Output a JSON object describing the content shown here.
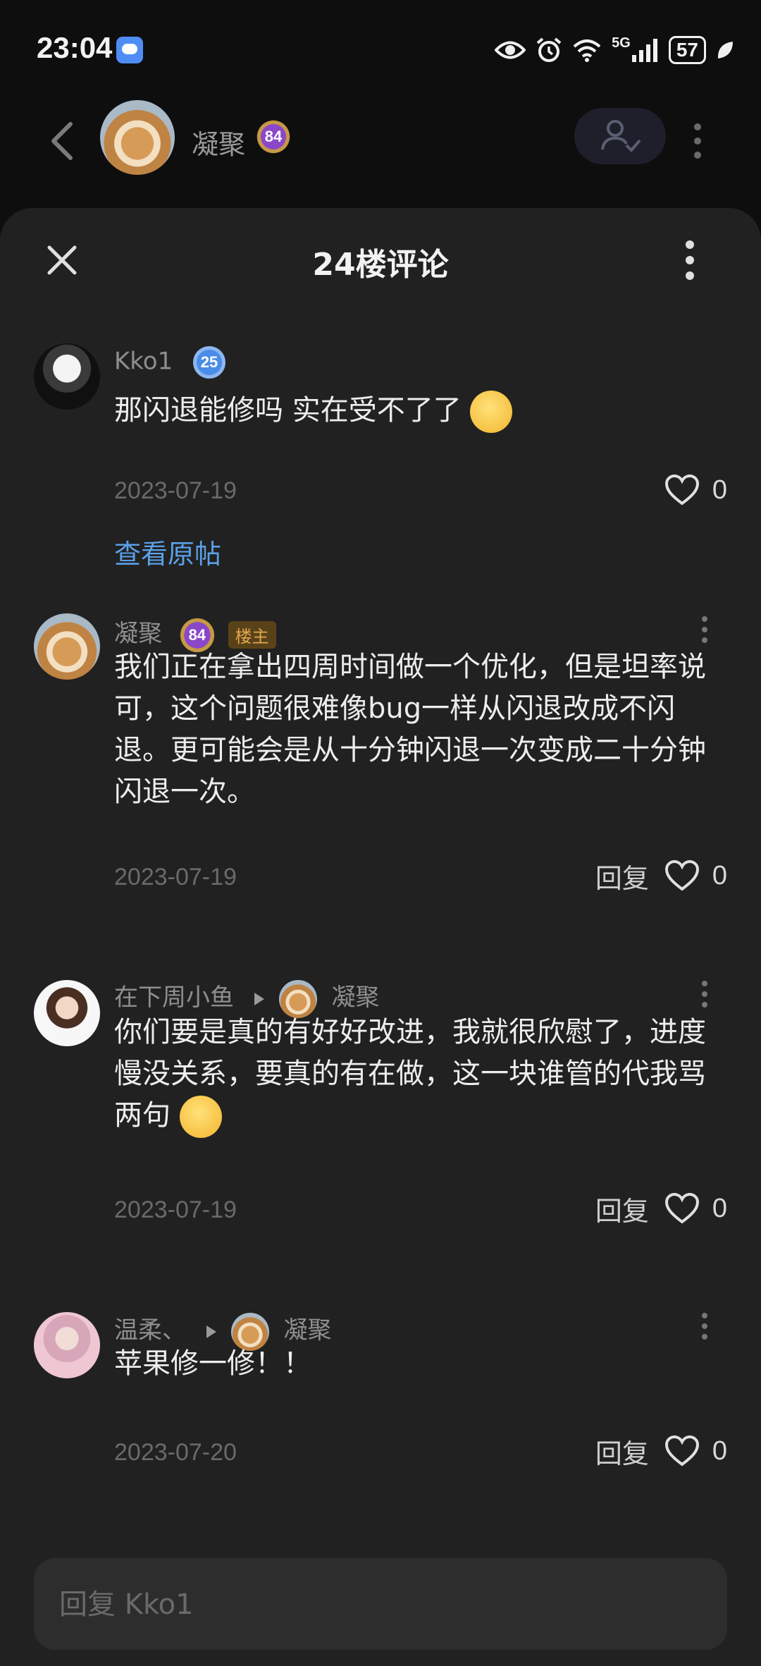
{
  "status_bar": {
    "time": "23:04",
    "network": "5G",
    "battery": "57"
  },
  "header": {
    "name": "凝聚",
    "level": "84"
  },
  "sheet": {
    "title": "24楼评论"
  },
  "main_comment": {
    "user": "Kko1",
    "level": "25",
    "text": "那闪退能修吗 实在受不了了",
    "date": "2023-07-19",
    "likes": "0",
    "view_original": "查看原帖"
  },
  "replies": [
    {
      "user": "凝聚",
      "level": "84",
      "tag": "楼主",
      "text": "我们正在拿出四周时间做一个优化，但是坦率说可，这个问题很难像bug一样从闪退改成不闪退。更可能会是从十分钟闪退一次变成二十分钟闪退一次。",
      "date": "2023-07-19",
      "reply_label": "回复",
      "likes": "0"
    },
    {
      "user": "在下周小鱼",
      "reply_to": "凝聚",
      "text": "你们要是真的有好好改进，我就很欣慰了，进度慢没关系，要真的有在做，这一块谁管的代我骂两句",
      "date": "2023-07-19",
      "reply_label": "回复",
      "likes": "0"
    },
    {
      "user": "温柔、",
      "reply_to": "凝聚",
      "text": "苹果修一修！！",
      "date": "2023-07-20",
      "reply_label": "回复",
      "likes": "0"
    }
  ],
  "input": {
    "placeholder": "回复 Kko1"
  },
  "colors": {
    "link": "#5aa0e8",
    "sheet_bg": "#212121",
    "op_tag_bg": "#5a4218",
    "op_tag_text": "#e0a64e"
  }
}
